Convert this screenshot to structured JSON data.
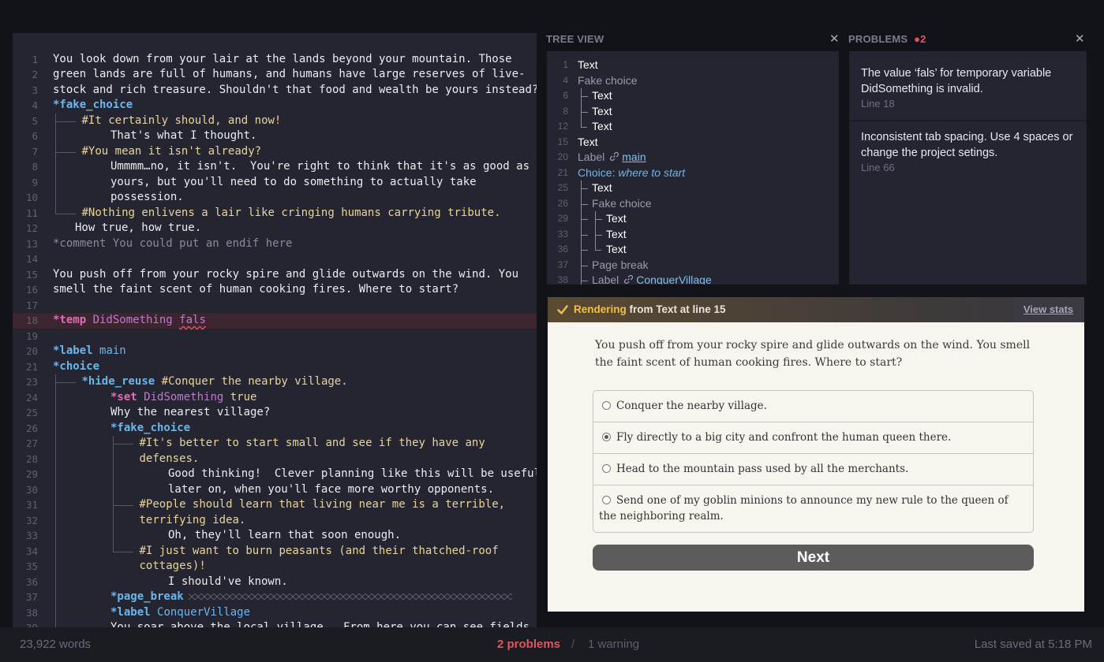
{
  "editor": {
    "lines": [
      {
        "n": "1",
        "parts": [
          {
            "t": "You look down from your lair at the lands beyond your mountain. Those"
          }
        ]
      },
      {
        "n": "2",
        "parts": [
          {
            "t": "green lands are full of humans, and humans have large reserves of live-"
          }
        ]
      },
      {
        "n": "3",
        "parts": [
          {
            "t": "stock and rich treasure. Shouldn't that food and wealth be yours instead?"
          }
        ]
      },
      {
        "n": "4",
        "parts": [
          {
            "t": "*fake_choice",
            "c": "c-cmd"
          }
        ]
      },
      {
        "n": "5",
        "g": [
          "branch"
        ],
        "parts": [
          {
            "t": "#It certainly should, and now!",
            "c": "c-opt"
          }
        ]
      },
      {
        "n": "6",
        "g": [
          "bar",
          "none"
        ],
        "parts": [
          {
            "t": "That's what I thought."
          }
        ]
      },
      {
        "n": "7",
        "g": [
          "branch"
        ],
        "parts": [
          {
            "t": "#You mean it isn't already?",
            "c": "c-opt"
          }
        ]
      },
      {
        "n": "8",
        "g": [
          "bar",
          "none"
        ],
        "parts": [
          {
            "t": "Ummmm…no, it isn't.  You're right to think that it's as good as"
          }
        ]
      },
      {
        "n": "9",
        "g": [
          "bar",
          "none"
        ],
        "parts": [
          {
            "t": "yours, but you'll need to do something to actually take"
          }
        ]
      },
      {
        "n": "10",
        "g": [
          "bar",
          "none"
        ],
        "parts": [
          {
            "t": "possession."
          }
        ]
      },
      {
        "n": "11",
        "g": [
          "last"
        ],
        "parts": [
          {
            "t": "#Nothing enlivens a lair like cringing humans carrying tribute.",
            "c": "c-opt"
          }
        ]
      },
      {
        "n": "12",
        "g": [
          "none"
        ],
        "pad": 28,
        "parts": [
          {
            "t": "How true, how true."
          }
        ]
      },
      {
        "n": "13",
        "parts": [
          {
            "t": "*comment You could put an endif here",
            "c": "c-comment"
          }
        ]
      },
      {
        "n": "14",
        "parts": []
      },
      {
        "n": "15",
        "parts": [
          {
            "t": "You push off from your rocky spire and glide outwards on the wind. You"
          }
        ]
      },
      {
        "n": "16",
        "parts": [
          {
            "t": "smell the faint scent of human cooking fires. Where to start?"
          }
        ]
      },
      {
        "n": "17",
        "parts": []
      },
      {
        "n": "18",
        "err": true,
        "parts": [
          {
            "t": "*temp ",
            "c": "c-pink"
          },
          {
            "t": "DidSomething ",
            "c": "c-var"
          },
          {
            "t": "fals",
            "c": "c-var squig"
          }
        ]
      },
      {
        "n": "19",
        "parts": []
      },
      {
        "n": "20",
        "parts": [
          {
            "t": "*label ",
            "c": "c-cmd"
          },
          {
            "t": "main",
            "c": "c-label"
          }
        ]
      },
      {
        "n": "21",
        "parts": [
          {
            "t": "*choice",
            "c": "c-cmd"
          }
        ]
      },
      {
        "n": "23",
        "g": [
          "branch"
        ],
        "parts": [
          {
            "t": "*hide_reuse ",
            "c": "c-cmd"
          },
          {
            "t": "#Conquer the nearby village.",
            "c": "c-opt"
          }
        ]
      },
      {
        "n": "24",
        "g": [
          "bar",
          "none"
        ],
        "parts": [
          {
            "t": "*set ",
            "c": "c-pink"
          },
          {
            "t": "DidSomething ",
            "c": "c-var"
          },
          {
            "t": "true",
            "c": "c-opt"
          }
        ]
      },
      {
        "n": "25",
        "g": [
          "bar",
          "none"
        ],
        "parts": [
          {
            "t": "Why the nearest village?"
          }
        ]
      },
      {
        "n": "26",
        "g": [
          "bar",
          "none"
        ],
        "parts": [
          {
            "t": "*fake_choice",
            "c": "c-cmd"
          }
        ]
      },
      {
        "n": "27",
        "g": [
          "bar",
          "none",
          "branch"
        ],
        "parts": [
          {
            "t": "#It's better to start small and see if they have any",
            "c": "c-opt"
          }
        ]
      },
      {
        "n": "28",
        "g": [
          "bar",
          "none",
          "bar"
        ],
        "parts": [
          {
            "t": "defenses.",
            "c": "c-opt"
          }
        ]
      },
      {
        "n": "29",
        "g": [
          "bar",
          "none",
          "bar",
          "none"
        ],
        "parts": [
          {
            "t": "Good thinking!  Clever planning like this will be useful"
          }
        ]
      },
      {
        "n": "30",
        "g": [
          "bar",
          "none",
          "bar",
          "none"
        ],
        "parts": [
          {
            "t": "later on, when you'll face more worthy opponents."
          }
        ]
      },
      {
        "n": "31",
        "g": [
          "bar",
          "none",
          "branch"
        ],
        "parts": [
          {
            "t": "#People should learn that living near me is a terrible,",
            "c": "c-opt"
          }
        ]
      },
      {
        "n": "32",
        "g": [
          "bar",
          "none",
          "bar"
        ],
        "parts": [
          {
            "t": "terrifying idea.",
            "c": "c-opt"
          }
        ]
      },
      {
        "n": "33",
        "g": [
          "bar",
          "none",
          "bar",
          "none"
        ],
        "parts": [
          {
            "t": "Oh, they'll learn that soon enough."
          }
        ]
      },
      {
        "n": "34",
        "g": [
          "bar",
          "none",
          "last"
        ],
        "parts": [
          {
            "t": "#I just want to burn peasants (and their thatched-roof",
            "c": "c-opt"
          }
        ]
      },
      {
        "n": "35",
        "g": [
          "bar",
          "none",
          "none"
        ],
        "parts": [
          {
            "t": "cottages)!",
            "c": "c-opt"
          }
        ]
      },
      {
        "n": "36",
        "g": [
          "bar",
          "none",
          "none",
          "none"
        ],
        "parts": [
          {
            "t": "I should've known."
          }
        ]
      },
      {
        "n": "37",
        "g": [
          "bar",
          "none"
        ],
        "zig": true,
        "parts": [
          {
            "t": "*page_break",
            "c": "c-cmd"
          }
        ]
      },
      {
        "n": "38",
        "g": [
          "bar",
          "none"
        ],
        "parts": [
          {
            "t": "*label ",
            "c": "c-cmd"
          },
          {
            "t": "ConquerVillage",
            "c": "c-label"
          }
        ]
      },
      {
        "n": "39",
        "g": [
          "bar",
          "none"
        ],
        "parts": [
          {
            "t": "You soar above the local village.  From here you can see fields"
          }
        ]
      }
    ]
  },
  "tree": {
    "title": "TREE VIEW",
    "rows": [
      {
        "n": "1",
        "d": 0,
        "label": "Text",
        "cls": "t-strong"
      },
      {
        "n": "4",
        "d": 0,
        "label": "Fake choice",
        "cls": "t-dim"
      },
      {
        "n": "6",
        "d": 1,
        "g": [
          "mid"
        ],
        "label": "Text",
        "cls": "t-strong"
      },
      {
        "n": "8",
        "d": 1,
        "g": [
          "mid"
        ],
        "label": "Text",
        "cls": "t-strong"
      },
      {
        "n": "12",
        "d": 1,
        "g": [
          "end"
        ],
        "label": "Text",
        "cls": "t-strong"
      },
      {
        "n": "15",
        "d": 0,
        "label": "Text",
        "cls": "t-strong"
      },
      {
        "n": "20",
        "d": 0,
        "label": "Label",
        "cls": "t-dim",
        "link": "main"
      },
      {
        "n": "21",
        "d": 0,
        "label": "Choice:",
        "cls": "t-choice",
        "italic": "where to start"
      },
      {
        "n": "25",
        "d": 1,
        "g": [
          "mid"
        ],
        "label": "Text",
        "cls": "t-strong"
      },
      {
        "n": "26",
        "d": 1,
        "g": [
          "mid"
        ],
        "label": "Fake choice",
        "cls": "t-dim"
      },
      {
        "n": "29",
        "d": 2,
        "g": [
          "mid",
          "mid"
        ],
        "label": "Text",
        "cls": "t-strong"
      },
      {
        "n": "33",
        "d": 2,
        "g": [
          "mid",
          "mid"
        ],
        "label": "Text",
        "cls": "t-strong"
      },
      {
        "n": "36",
        "d": 2,
        "g": [
          "mid",
          "end"
        ],
        "label": "Text",
        "cls": "t-strong"
      },
      {
        "n": "37",
        "d": 1,
        "g": [
          "mid"
        ],
        "label": "Page break",
        "cls": "t-dim"
      },
      {
        "n": "38",
        "d": 1,
        "g": [
          "mid"
        ],
        "label": "Label",
        "cls": "t-dim",
        "link": "ConquerVillage"
      }
    ]
  },
  "problems": {
    "title": "PROBLEMS",
    "count": "2",
    "items": [
      {
        "text": "The value ‘fals’ for temporary variable DidSomething is invalid.",
        "line": "Line 18"
      },
      {
        "text": "Inconsistent tab spacing. Use 4 spaces or change the project setings.",
        "line": "Line 66"
      }
    ]
  },
  "render": {
    "status_word": "Rendering",
    "status_rest": "from Text at line 15",
    "view_stats": "View stats",
    "paragraph": "You push off from your rocky spire and glide outwards on the wind. You smell the faint scent of human cooking fires. Where to start?",
    "options": [
      {
        "label": "Conquer the nearby village.",
        "selected": false
      },
      {
        "label": "Fly directly to a big city and confront the human queen there.",
        "selected": true
      },
      {
        "label": "Head to the mountain pass used by all the merchants.",
        "selected": false
      },
      {
        "label": "Send one of my goblin minions to announce my new rule to the queen of the neighboring realm.",
        "selected": false
      }
    ],
    "next": "Next"
  },
  "status": {
    "words": "23,922 words",
    "problems": "2 problems",
    "sep": "/",
    "warnings": "1 warning",
    "saved": "Last saved at 5:18 PM"
  },
  "colors": {
    "accent": "#6bb6ea",
    "error": "#e05560",
    "rendering": "#f0bf4c"
  }
}
